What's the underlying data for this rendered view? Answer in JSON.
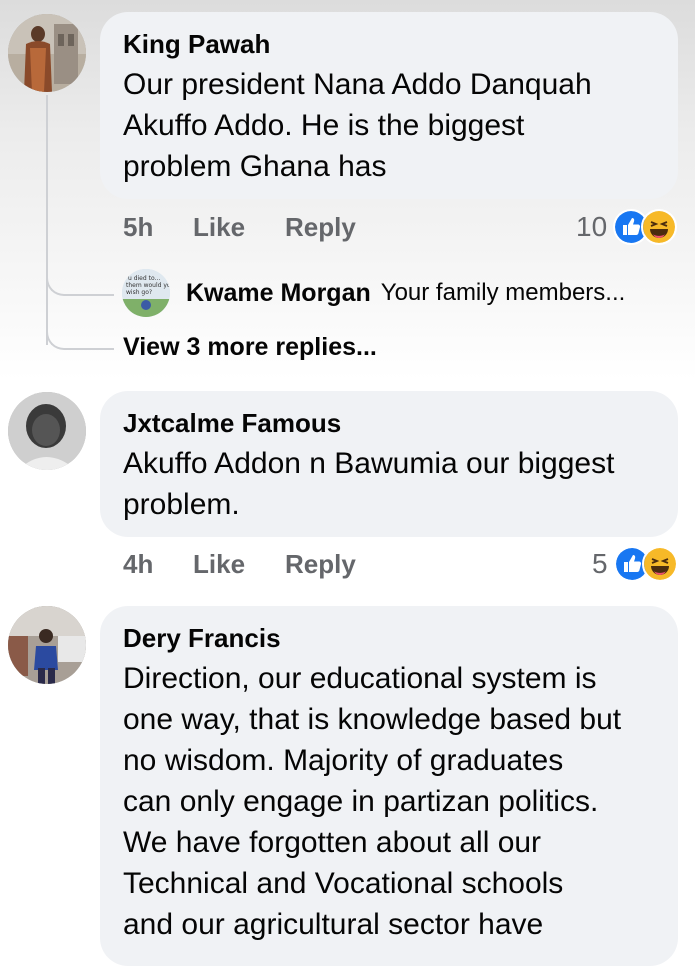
{
  "comments": [
    {
      "author": "King Pawah",
      "body": "Our president Nana Addo Danquah\nAkuffo Addo. He is the biggest\nproblem Ghana has",
      "time": "5h",
      "like": "Like",
      "reply": "Reply",
      "reaction_count": "10",
      "reactions": [
        "like-reaction-icon",
        "haha-reaction-icon"
      ]
    },
    {
      "author": "Jxtcalme Famous",
      "body": "Akuffo Addon n Bawumia our biggest\nproblem.",
      "time": "4h",
      "like": "Like",
      "reply": "Reply",
      "reaction_count": "5",
      "reactions": [
        "like-reaction-icon",
        "haha-reaction-icon"
      ]
    },
    {
      "author": "Dery Francis",
      "body": "Direction, our educational system is\none way, that is knowledge based but\nno wisdom. Majority of graduates\ncan only engage in partizan politics.\nWe have forgotten about all our\nTechnical and Vocational schools\nand our agricultural sector have"
    }
  ],
  "reply_preview": {
    "author": "Kwame Morgan",
    "snippet": "Your family members...",
    "avatar_text": "u died to...\nthem would yo\nwish go?"
  },
  "view_more_replies": "View 3 more replies...",
  "colors": {
    "bubble": "#f0f2f5",
    "meta_text": "#65676b",
    "like_blue": "#1877f2",
    "haha_yellow": "#f7b928",
    "thread_line": "#ced0d4"
  }
}
